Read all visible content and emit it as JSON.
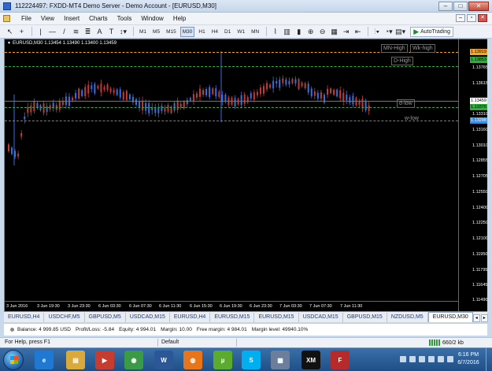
{
  "window": {
    "title": "112224497: FXDD-MT4 Demo Server - Demo Account - [EURUSD,M30]",
    "minimize": "–",
    "maximize": "□",
    "close": "✕"
  },
  "menu": {
    "items": [
      "File",
      "View",
      "Insert",
      "Charts",
      "Tools",
      "Window",
      "Help"
    ],
    "mdi_min": "–",
    "mdi_restore": "▫",
    "mdi_close": "✕"
  },
  "toolbar": {
    "periods": [
      "M1",
      "M5",
      "M15",
      "M30",
      "H1",
      "H4",
      "D1",
      "W1",
      "MN"
    ],
    "active_period": "M30",
    "autotrading_label": "AutoTrading"
  },
  "chart": {
    "header": "EURUSD,M30  1.13454 1.13490 1.13400 1.13459",
    "colors": {
      "background": "#000000",
      "bull": "#3a6fe0",
      "bear": "#c23b3b",
      "axis_text": "#ffffff"
    },
    "price_labels": [
      "1.13765",
      "1.13615",
      "1.13310",
      "1.13160",
      "1.13010",
      "1.12855",
      "1.12705",
      "1.12550",
      "1.12400",
      "1.12250",
      "1.12100",
      "1.11950",
      "1.11795",
      "1.11645",
      "1.11490"
    ],
    "price_tags": [
      {
        "text": "1.13919",
        "color": "#f5a623"
      },
      {
        "text": "1.13853",
        "color": "#2fae3a"
      },
      {
        "text": "1.13459",
        "color": "#ffffff"
      },
      {
        "text": "1.13376",
        "color": "#2fae3a"
      },
      {
        "text": "1.13298",
        "color": "#3a8ee0"
      }
    ],
    "time_labels": [
      "3 Jun 2016",
      "3 Jun 19:30",
      "3 Jun 23:30",
      "6 Jun 03:30",
      "6 Jun 07:30",
      "6 Jun 11:30",
      "6 Jun 15:30",
      "6 Jun 19:30",
      "6 Jun 23:30",
      "7 Jun 03:30",
      "7 Jun 07:30",
      "7 Jun 11:30"
    ],
    "levels": {
      "mn_high": "MN-High",
      "wk_high": "Wk-high",
      "d_high": "D-High",
      "d_low": "d-low",
      "w_low": "w-low"
    }
  },
  "chart_tabs": [
    "EURUSD,H4",
    "USDCHF,M5",
    "GBPUSD,M5",
    "USDCAD,M15",
    "EURUSD,H4",
    "EURUSD,M15",
    "EURUSD,M15",
    "USDCAD,M15",
    "GBPUSD,M15",
    "NZDUSD,M5",
    "EURUSD,M30"
  ],
  "active_tab": "EURUSD,M30",
  "terminal": {
    "balance": "Balance: 4 999.85 USD",
    "profit": "Profit/Loss: -5.84",
    "equity": "Equity: 4 994.01",
    "margin": "Margin: 10.00",
    "free_margin": "Free margin: 4 984.01",
    "margin_level": "Margin level: 49940.10%"
  },
  "status": {
    "help": "For Help, press F1",
    "profile": "Default",
    "traffic": "660/2 kb"
  },
  "taskbar": {
    "apps": [
      {
        "name": "ie",
        "label": "e",
        "color": "#1f78d1"
      },
      {
        "name": "explorer",
        "label": "▤",
        "color": "#d9a93a"
      },
      {
        "name": "media",
        "label": "▶",
        "color": "#c63d2f"
      },
      {
        "name": "chrome",
        "label": "◉",
        "color": "#3b9a45"
      },
      {
        "name": "word",
        "label": "W",
        "color": "#2b5797"
      },
      {
        "name": "firefox",
        "label": "◍",
        "color": "#e8751a"
      },
      {
        "name": "utorrent",
        "label": "µ",
        "color": "#5bab2c"
      },
      {
        "name": "skype",
        "label": "S",
        "color": "#00aff0"
      },
      {
        "name": "chart-app",
        "label": "▦",
        "color": "#6b7f9c"
      },
      {
        "name": "xm",
        "label": "XM",
        "color": "#111111"
      },
      {
        "name": "fxdd",
        "label": "F",
        "color": "#b72a2a"
      }
    ],
    "time": "6:16 PM",
    "date": "6/7/2016"
  }
}
